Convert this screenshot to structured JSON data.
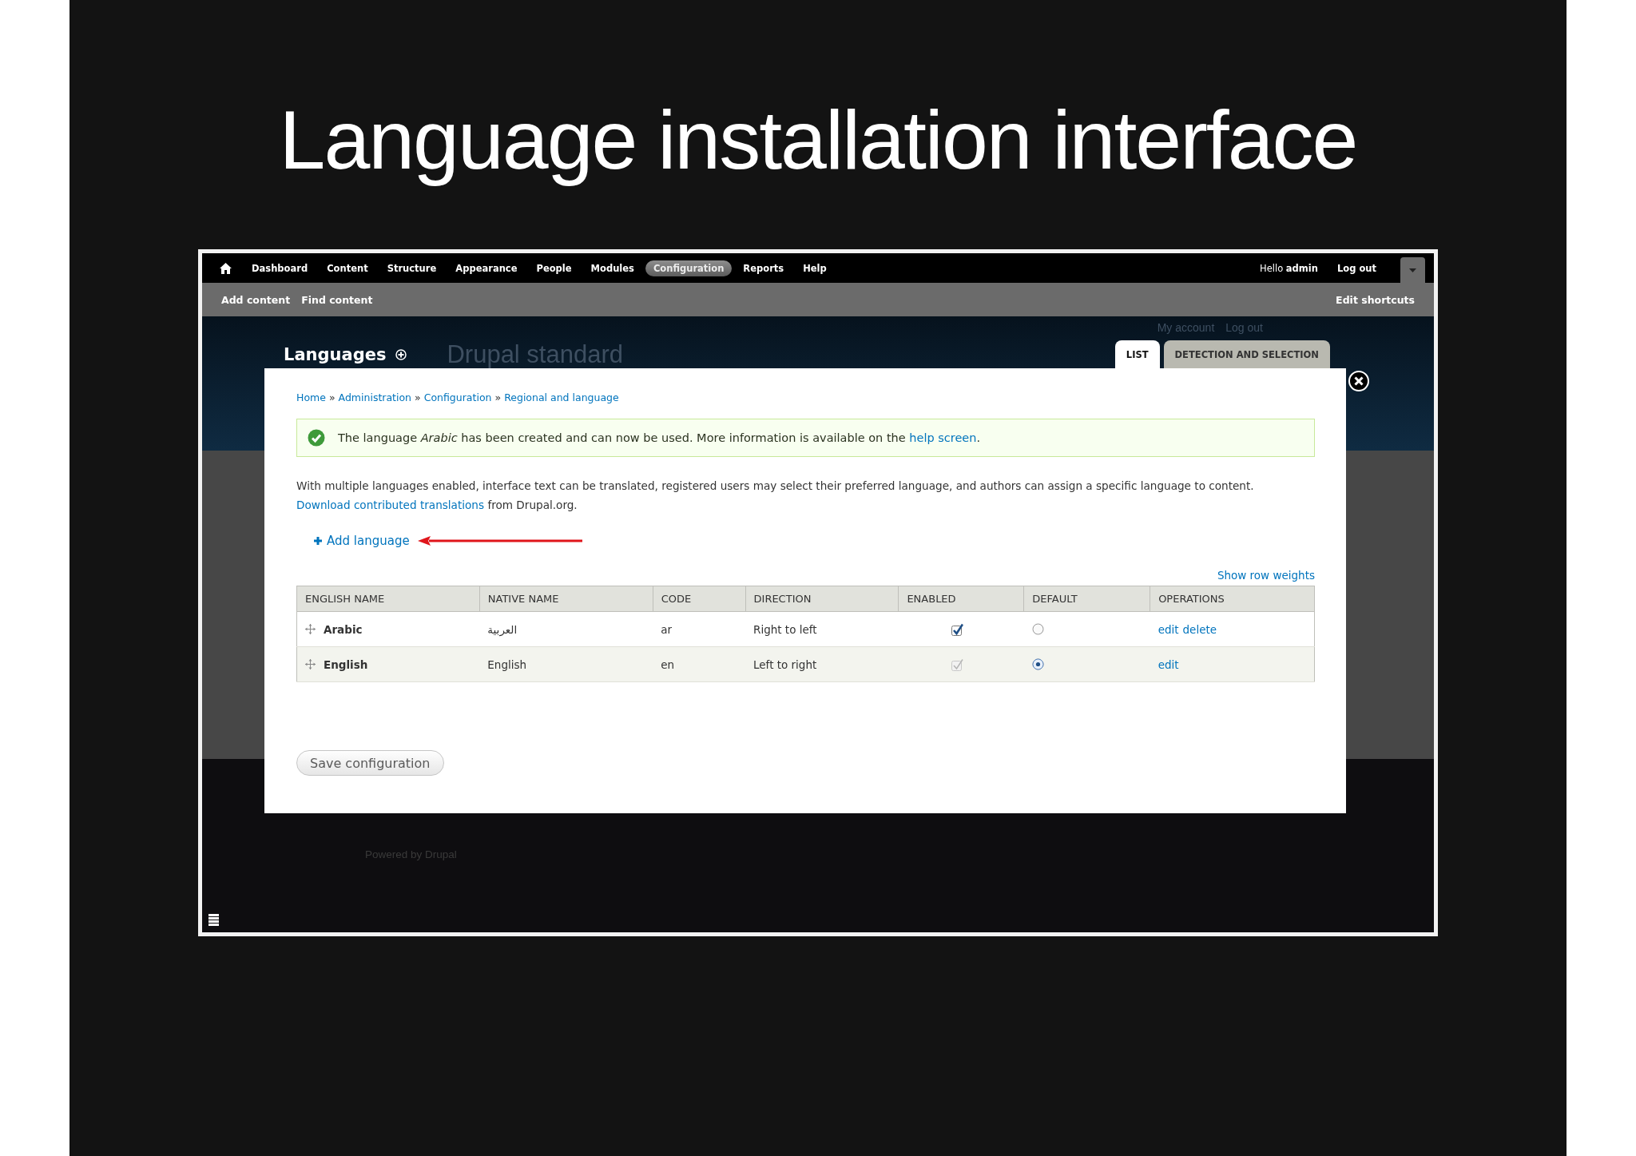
{
  "slide": {
    "title": "Language installation interface"
  },
  "toolbar": {
    "items": [
      {
        "label": "Dashboard",
        "selected": false
      },
      {
        "label": "Content",
        "selected": false
      },
      {
        "label": "Structure",
        "selected": false
      },
      {
        "label": "Appearance",
        "selected": false
      },
      {
        "label": "People",
        "selected": false
      },
      {
        "label": "Modules",
        "selected": false
      },
      {
        "label": "Configuration",
        "selected": true
      },
      {
        "label": "Reports",
        "selected": false
      },
      {
        "label": "Help",
        "selected": false
      }
    ],
    "user_greeting": "Hello **admin**",
    "logout": "Log out"
  },
  "shortcuts": {
    "items": [
      "Add content",
      "Find content"
    ],
    "edit": "Edit shortcuts"
  },
  "header": {
    "title": "Languages",
    "site_name": "Drupal standard",
    "secondary_links": [
      "My account",
      "Log out"
    ]
  },
  "tabs": [
    {
      "label": "LIST",
      "selected": true
    },
    {
      "label": "DETECTION AND SELECTION",
      "selected": false
    }
  ],
  "dialog": {
    "breadcrumb": {
      "separator": "»",
      "items": [
        "Home",
        "Administration",
        "Configuration",
        "Regional and language"
      ]
    },
    "message": {
      "text": "The language *Arabic* has been created and can now be used. More information is available on the",
      "link": "help screen",
      "end": "."
    },
    "description": {
      "text": "With multiple languages enabled, interface text can be translated, registered users may select their preferred language, and authors can assign a specific language to content.",
      "link": "Download contributed translations",
      "end": "from Drupal.org."
    },
    "add_language": "Add language",
    "show_row_weights": "Show row weights",
    "table": {
      "columns": [
        "ENGLISH NAME",
        "NATIVE NAME",
        "CODE",
        "DIRECTION",
        "ENABLED",
        "DEFAULT",
        "OPERATIONS"
      ],
      "rows": [
        {
          "english_name": "Arabic",
          "native_name": "العربية",
          "code": "ar",
          "direction": "Right to left",
          "enabled": true,
          "disabled": false,
          "default": false,
          "operations": [
            "edit",
            "delete"
          ]
        },
        {
          "english_name": "English",
          "native_name": "English",
          "code": "en",
          "direction": "Left to right",
          "enabled": true,
          "disabled": true,
          "default": true,
          "operations": [
            "edit"
          ]
        }
      ]
    },
    "save_button": "Save configuration"
  },
  "footer": "Powered by Drupal"
}
